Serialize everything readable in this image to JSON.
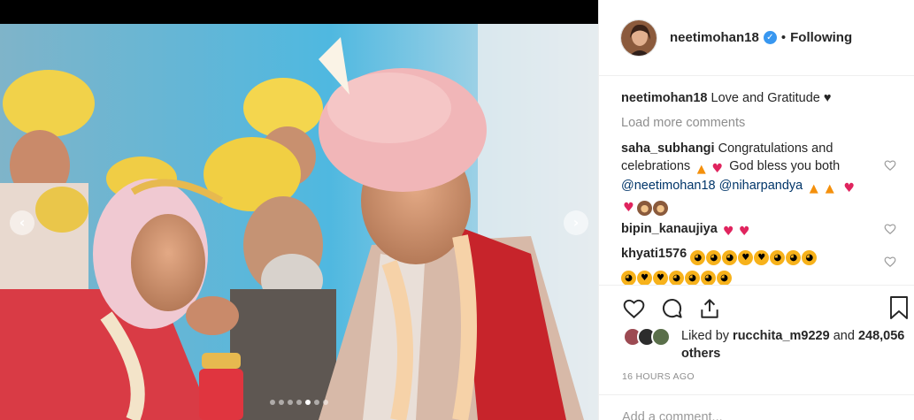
{
  "post": {
    "photo_alt": "",
    "carousel": {
      "count": 7,
      "active_index": 4
    }
  },
  "header": {
    "username": "neetimohan18",
    "separator": "•",
    "follow_status": "Following",
    "verified_glyph": "✓"
  },
  "comments": {
    "caption": {
      "user": "neetimohan18",
      "text": "Love and Gratitude ♥"
    },
    "load_more_label": "Load more comments",
    "items": [
      {
        "user": "saha_subhangi",
        "text_part1": "Congratulations and celebrations",
        "text_part2": "God bless you both",
        "mention1": "@neetimohan18",
        "mention2": "@niharpandya"
      },
      {
        "user": "bipin_kanaujiya"
      },
      {
        "user": "khyati1576"
      }
    ]
  },
  "likes": {
    "prefix": "Liked by",
    "user": "rucchita_m9229",
    "conjunction": "and",
    "others": "248,056 others"
  },
  "timestamp": "16 HOURS AGO",
  "add_comment": {
    "placeholder": "Add a comment..."
  },
  "colors": {
    "verified": "#3897f0",
    "mention": "#003569",
    "muted": "#8e8e8e",
    "heart": "#ed4956"
  },
  "icons": [
    "heart-icon",
    "comment-icon",
    "share-icon",
    "bookmark-icon",
    "chevron-left-icon",
    "chevron-right-icon",
    "verified-badge-icon"
  ]
}
